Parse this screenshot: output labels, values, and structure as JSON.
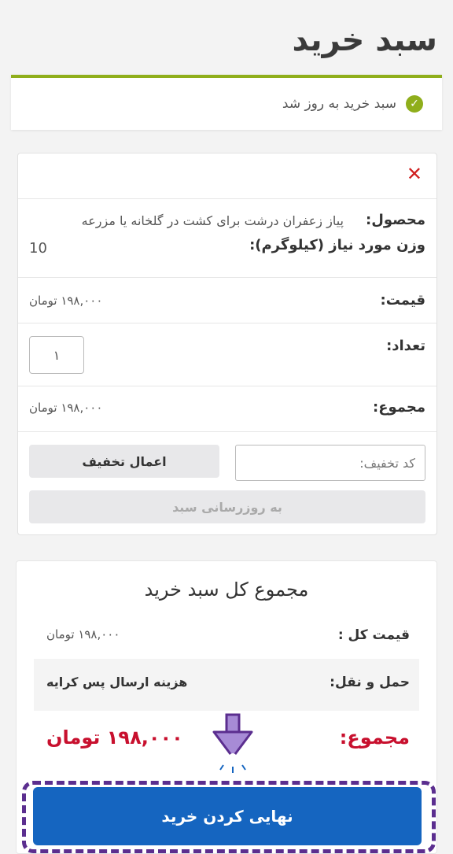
{
  "page": {
    "title": "سبد خرید"
  },
  "notice": {
    "text": "سبد خرید به روز شد"
  },
  "cart_item": {
    "product_label": "محصول:",
    "product_name": "پیاز زعفران درشت برای کشت در گلخانه یا مزرعه",
    "weight_label": "وزن مورد نیاز (کیلوگرم):",
    "weight_value": "10",
    "price_label": "قیمت:",
    "price_value": "۱۹۸,۰۰۰ تومان",
    "qty_label": "تعداد:",
    "qty_value": "۱",
    "subtotal_label": "مجموع:",
    "subtotal_value": "۱۹۸,۰۰۰ تومان"
  },
  "coupon": {
    "placeholder": "کد تخفیف:",
    "apply_label": "اعمال تخفیف",
    "update_label": "به روزرسانی سبد"
  },
  "totals": {
    "title": "مجموع کل سبد خرید",
    "subtotal_label": "قیمت کل :",
    "subtotal_value": "۱۹۸,۰۰۰ تومان",
    "shipping_label": "حمل و نقل:",
    "shipping_value": "هزینه ارسال پس کرایه",
    "total_label": "مجموع:",
    "total_value": "۱۹۸,۰۰۰ تومان"
  },
  "checkout": {
    "label": "نهایی کردن خرید"
  },
  "colors": {
    "accent_green": "#8fae1b",
    "remove_red": "#d01f1f",
    "total_red": "#c8102e",
    "checkout_blue": "#1565c0",
    "highlight_purple": "#5b2e8f"
  }
}
